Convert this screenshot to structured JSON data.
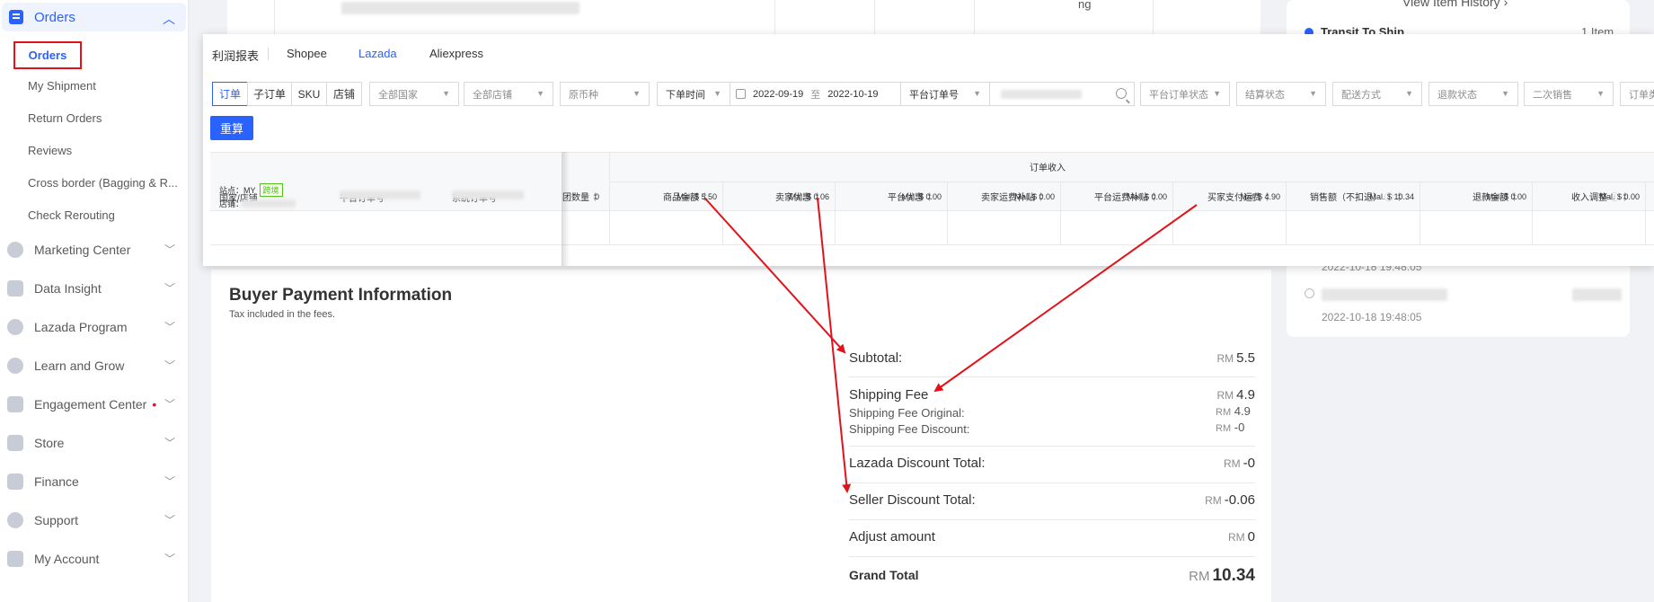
{
  "sidebar": {
    "orders_header": "Orders",
    "sub_items": [
      "Orders",
      "My Shipment",
      "Return Orders",
      "Reviews",
      "Cross border (Bagging & R...",
      "Check Rerouting"
    ],
    "items": [
      {
        "label": "Marketing Center",
        "dot": ""
      },
      {
        "label": "Data Insight",
        "dot": ""
      },
      {
        "label": "Lazada Program",
        "dot": ""
      },
      {
        "label": "Learn and Grow",
        "dot": ""
      },
      {
        "label": "Engagement Center",
        "dot": "•"
      },
      {
        "label": "Store",
        "dot": ""
      },
      {
        "label": "Finance",
        "dot": ""
      },
      {
        "label": "Support",
        "dot": ""
      },
      {
        "label": "My Account",
        "dot": ""
      }
    ]
  },
  "background": {
    "ng": "ng",
    "view_history": "View Item History",
    "transit": "Transit To Ship",
    "items_count": "1 Item",
    "ts1": "2022-10-18 19:48:05",
    "ts2": "2022-10-18 19:48:05"
  },
  "panel": {
    "tabs": [
      "利润报表",
      "Shopee",
      "Lazada",
      "Aliexpress"
    ],
    "seg": [
      "订单",
      "子订单",
      "SKU",
      "店铺"
    ],
    "filters": {
      "country": "全部国家",
      "store": "全部店铺",
      "currency": "原币种",
      "time": "下单时间",
      "date_from": "2022-09-19",
      "date_sep": "至",
      "date_to": "2022-10-19",
      "order_no": "平台订单号",
      "order_status": "平台订单状态",
      "settle_status": "结算状态",
      "delivery": "配送方式",
      "refund_status": "退款状态",
      "secondary": "二次销售",
      "order_type": "订单类"
    },
    "reset": "重算",
    "income_header": "订单收入",
    "columns": [
      "国家/店铺",
      "平台订单号",
      "系统订单号",
      "团数量",
      "商品金额",
      "卖家优惠",
      "平台优惠",
      "卖家运费补贴",
      "平台运费补贴",
      "买家支付运费",
      "销售额（不扣退）",
      "退款金额",
      "收入调整"
    ],
    "row": {
      "site_label": "站点：",
      "site": "MY",
      "tag": "跨境",
      "store_label": "店铺：",
      "qty": "0",
      "values": [
        "Mal. $ 5.50",
        "Mal. $ 0.06",
        "Mal. $ 0.00",
        "Mal. $ 0.00",
        "Mal. $ 0.00",
        "Mal. $ 4.90",
        "Mal. $ 10.34",
        "Mal. $ 0.00",
        "Mal. $ 0.00"
      ]
    }
  },
  "payment": {
    "title": "Buyer Payment Information",
    "subtitle": "Tax included in the fees.",
    "currency": "RM",
    "subtotal_label": "Subtotal:",
    "subtotal": "5.5",
    "shipping_label": "Shipping Fee",
    "shipping": "4.9",
    "shipping_original_label": "Shipping Fee Original:",
    "shipping_original": "4.9",
    "shipping_discount_label": "Shipping Fee Discount:",
    "shipping_discount": "-0",
    "lazada_discount_label": "Lazada Discount Total:",
    "lazada_discount": "-0",
    "seller_discount_label": "Seller Discount Total:",
    "seller_discount": "-0.06",
    "adjust_label": "Adjust amount",
    "adjust": "0",
    "grand_label": "Grand Total",
    "grand": "10.34"
  },
  "colors": {
    "accent": "#2962ff",
    "annotation": "#e0131a"
  }
}
